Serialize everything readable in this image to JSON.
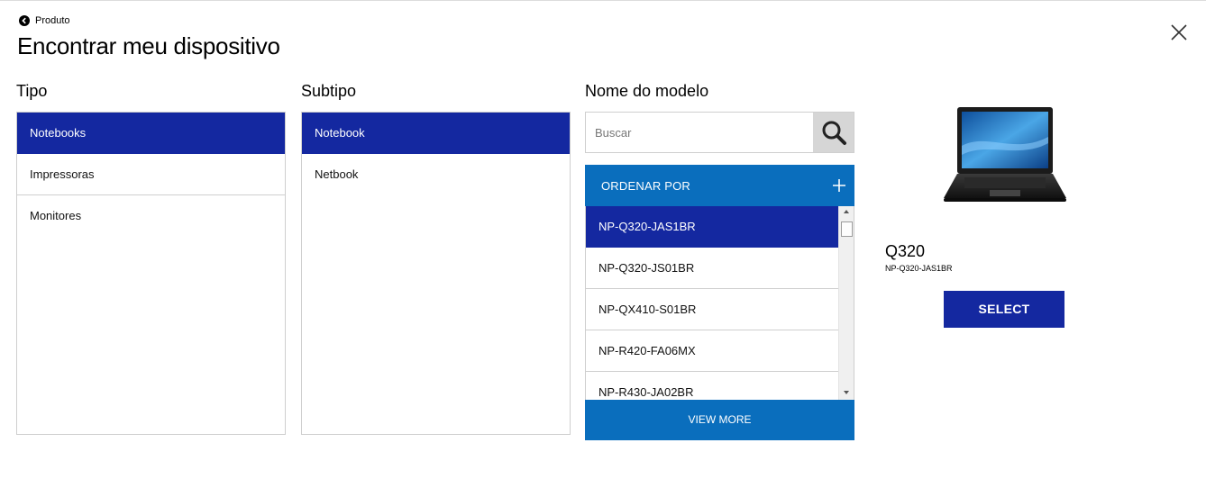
{
  "header": {
    "back_label": "Produto",
    "title": "Encontrar meu dispositivo"
  },
  "columns": {
    "tipo": {
      "title": "Tipo",
      "items": [
        {
          "label": "Notebooks",
          "selected": true
        },
        {
          "label": "Impressoras",
          "selected": false
        },
        {
          "label": "Monitores",
          "selected": false
        }
      ]
    },
    "subtipo": {
      "title": "Subtipo",
      "items": [
        {
          "label": "Notebook",
          "selected": true
        },
        {
          "label": "Netbook",
          "selected": false
        }
      ]
    },
    "modelo": {
      "title": "Nome do modelo",
      "search_placeholder": "Buscar",
      "search_value": "",
      "sort_label": "ORDENAR POR",
      "items": [
        {
          "label": "NP-Q320-JAS1BR",
          "selected": true
        },
        {
          "label": "NP-Q320-JS01BR",
          "selected": false
        },
        {
          "label": "NP-QX410-S01BR",
          "selected": false
        },
        {
          "label": "NP-R420-FA06MX",
          "selected": false
        },
        {
          "label": "NP-R430-JA02BR",
          "selected": false
        }
      ],
      "view_more_label": "VIEW MORE"
    }
  },
  "product": {
    "name": "Q320",
    "code": "NP-Q320-JAS1BR",
    "select_label": "SELECT"
  },
  "colors": {
    "selected": "#1428a0",
    "accent_blue": "#0a6ebd"
  }
}
